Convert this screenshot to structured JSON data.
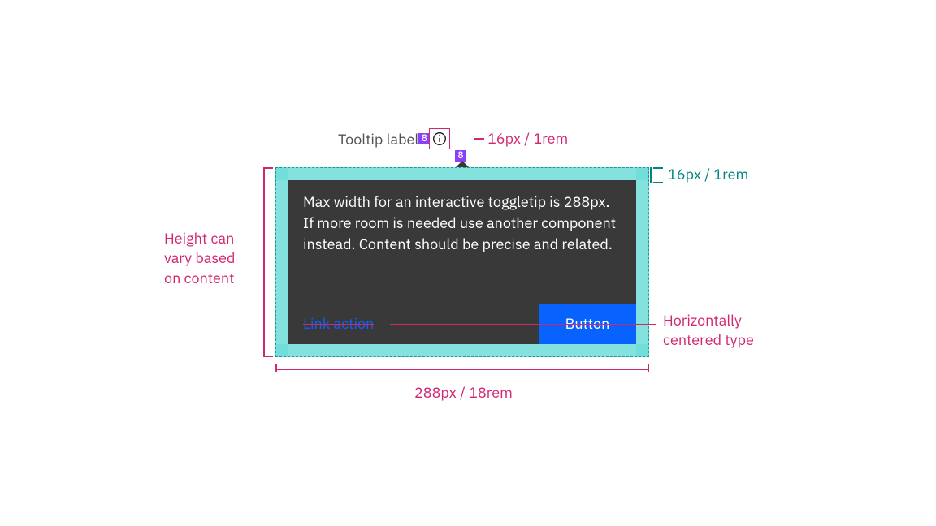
{
  "title": "Tooltip label",
  "spacing_token": "8",
  "icon_size_note": "16px / 1rem",
  "padding_note": "16px / 1rem",
  "height_note": "Height can\nvary based\non content",
  "body": "Max width for an interactive toggletip is 288px. If more room is needed use another component instead. Content should be precise and related.",
  "link_label": "Link action",
  "button_label": "Button",
  "centered_note": "Horizontally\ncentered type",
  "width_note": "288px / 18rem"
}
